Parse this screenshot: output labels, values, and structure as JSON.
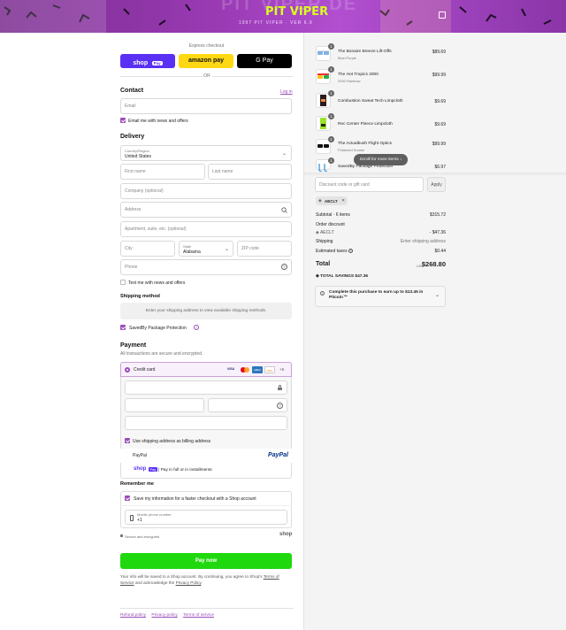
{
  "banner": {
    "logo_text": "PIT VIPER",
    "sub_text": "1997 PIT VIPER · VER 6.9",
    "bg_text": "PIT VIPER DE"
  },
  "express": {
    "label": "Express checkout",
    "shop_label": "shop",
    "shop_badge": "Pay",
    "amazon_label": "amazon pay",
    "gpay_label": "G Pay",
    "or_label": "OR"
  },
  "contact": {
    "title": "Contact",
    "login": "Log in",
    "email_placeholder": "Email",
    "news_label": "Email me with news and offers"
  },
  "delivery": {
    "title": "Delivery",
    "country_label": "Country/Region",
    "country_value": "United States",
    "first_name": "First name",
    "last_name": "Last name",
    "company": "Company (optional)",
    "address": "Address",
    "apartment": "Apartment, suite, etc. (optional)",
    "city": "City",
    "state_label": "State",
    "state_value": "Alabama",
    "zip": "ZIP code",
    "phone": "Phone",
    "text_label": "Text me with news and offers"
  },
  "shipping": {
    "title": "Shipping method",
    "message": "Enter your shipping address to view available shipping methods.",
    "savedby_label": "SavedBy Package Protection"
  },
  "payment": {
    "title": "Payment",
    "subtitle": "All transactions are secure and encrypted.",
    "credit_card": "Credit card",
    "more_cards": "+6",
    "card_badges": [
      "VISA",
      "MC",
      "AMEX",
      "DISC"
    ],
    "billing_label": "Use shipping address as billing address",
    "paypal": "PayPal",
    "paypal_logo": "PayPal",
    "shoppay_text": "| Pay in full or in installments",
    "shoppay_logo": "shop",
    "shoppay_badge": "Pay"
  },
  "remember": {
    "title": "Remember me",
    "save_label": "Save my information for a faster checkout with a Shop account",
    "phone_label": "Mobile phone number",
    "phone_value": "+1",
    "secure": "Secure and encrypted",
    "shop_logo": "shop"
  },
  "pay_button": "Pay now",
  "legal": {
    "part1": "Your info will be saved to a Shop account. By continuing, you agree to Shop's ",
    "terms": "Terms of Service",
    "part2": " and acknowledge the ",
    "privacy": "Privacy Policy",
    "end": "."
  },
  "footer": {
    "links": [
      "Refund policy",
      "Privacy policy",
      "Terms of service"
    ]
  },
  "summary": {
    "items": [
      {
        "qty": "1",
        "name": "The Bonaire Breeze Lift-Offs",
        "variant": "Blue-Purple",
        "price": "$89.69"
      },
      {
        "qty": "1",
        "name": "The Hot Tropics 2000",
        "variant": "2000 Rainbow",
        "price": "$99.99"
      },
      {
        "qty": "1",
        "name": "Combustion Sweat Tech Limpcloth",
        "variant": "",
        "price": "$9.69"
      },
      {
        "qty": "1",
        "name": "Rec Center Fleece Limpcloth",
        "variant": "",
        "price": "$9.69"
      },
      {
        "qty": "1",
        "name": "The Actualbush Flight Optics",
        "variant": "Polarized Smoke",
        "price": "$99.99"
      },
      {
        "qty": "1",
        "name": "SavedBy Package Protection",
        "variant": "",
        "price": "$6.97"
      }
    ],
    "scroll_pill": "Scroll for more items",
    "discount_placeholder": "Discount code or gift card",
    "apply": "Apply",
    "code_tag": "AECLT",
    "subtotal_label": "Subtotal · 6 items",
    "subtotal_value": "$315.72",
    "order_discount_label": "Order discount",
    "discount_code": "AECLT",
    "discount_value": "- $47.36",
    "shipping_label": "Shipping",
    "shipping_value": "Enter shipping address",
    "taxes_label": "Estimated taxes",
    "taxes_value": "$0.44",
    "total_label": "Total",
    "currency": "USD",
    "total_value": "$268.80",
    "savings_label": "TOTAL SAVINGS",
    "savings_value": "$47.36",
    "earn_text": "Complete this purchase to earn up to $13.45 in Pitcoin™"
  }
}
